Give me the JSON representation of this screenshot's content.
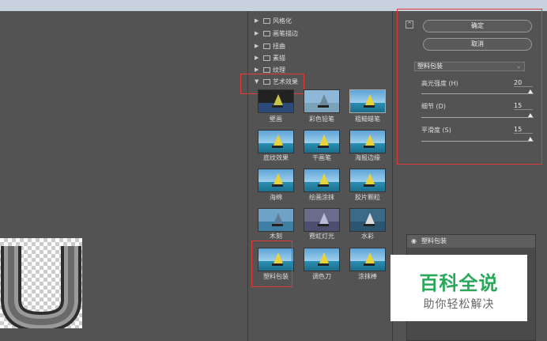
{
  "filter_tree": [
    {
      "label": "风格化",
      "expanded": false
    },
    {
      "label": "画笔描边",
      "expanded": false
    },
    {
      "label": "扭曲",
      "expanded": false
    },
    {
      "label": "素描",
      "expanded": false
    },
    {
      "label": "纹理",
      "expanded": false
    },
    {
      "label": "艺术效果",
      "expanded": true
    }
  ],
  "thumbnails": [
    "壁画",
    "彩色铅笔",
    "粗糙蜡笔",
    "底纹效果",
    "干画笔",
    "海报边缘",
    "海绵",
    "绘画涂抹",
    "胶片颗粒",
    "木刻",
    "霓虹灯光",
    "水彩",
    "塑料包装",
    "调色刀",
    "涂抹棒"
  ],
  "buttons": {
    "ok": "确定",
    "cancel": "取消"
  },
  "collapse_icon": "collapse-icon",
  "filter_select": {
    "value": "塑料包装"
  },
  "params": [
    {
      "label": "高光强度 (H)",
      "value": "20"
    },
    {
      "label": "细节 (D)",
      "value": "15"
    },
    {
      "label": "平滑度 (S)",
      "value": "15"
    }
  ],
  "layer": {
    "name": "塑料包装"
  },
  "watermark": {
    "line1": "百科全说",
    "line2": "助你轻松解决"
  },
  "colors": {
    "highlight": "#e23a3a",
    "watermark_green": "#2aa85a"
  }
}
